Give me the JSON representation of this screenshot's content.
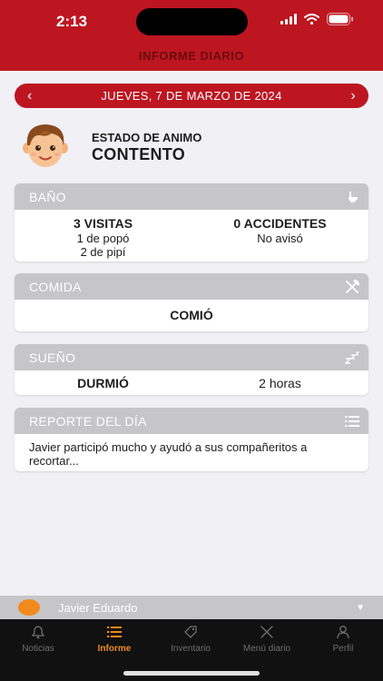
{
  "status": {
    "time": "2:13"
  },
  "header": {
    "title": "INFORME DIARIO"
  },
  "date_nav": {
    "date": "JUEVES, 7 DE MARZO DE 2024",
    "prev": "‹",
    "next": "›"
  },
  "mood": {
    "label": "ESTADO DE ANIMO",
    "value": "CONTENTO"
  },
  "bano": {
    "title": "BAÑO",
    "visits": {
      "headline": "3 VISITAS",
      "line1": "1 de popó",
      "line2": "2 de pipí"
    },
    "accidents": {
      "headline": "0 ACCIDENTES",
      "line1": "No avisó"
    }
  },
  "comida": {
    "title": "COMIDA",
    "value": "COMIÓ"
  },
  "sueno": {
    "title": "SUEÑO",
    "status": "DURMIÓ",
    "duration": "2 horas"
  },
  "reporte": {
    "title": "REPORTE DEL DÍA",
    "text": "Javier participó mucho y ayudó a sus compañeritos a recortar..."
  },
  "child": {
    "name": "Javier Eduardo",
    "color": "#f08a1c"
  },
  "tabs": [
    {
      "label": "Noticias"
    },
    {
      "label": "Informe"
    },
    {
      "label": "Inventario"
    },
    {
      "label": "Menú diario"
    },
    {
      "label": "Perfil"
    }
  ],
  "colors": {
    "brand": "#bd1621",
    "accent": "#f08a1c",
    "card_header": "#c6c6c9"
  }
}
